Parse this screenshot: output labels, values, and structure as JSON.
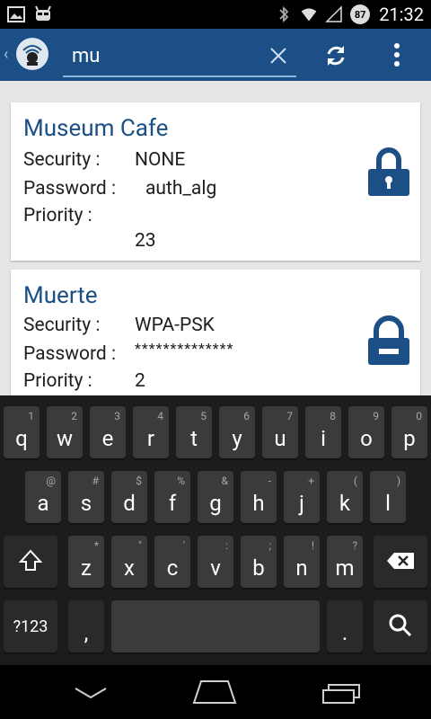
{
  "status": {
    "time": "21:32",
    "battery": "87"
  },
  "search": {
    "value": "mu"
  },
  "networks": [
    {
      "name": "Museum Cafe",
      "security_label": "Security :",
      "security": "NONE",
      "password_label": "Password :",
      "password": "auth_alg",
      "priority_label": "Priority :",
      "priority": "23"
    },
    {
      "name": "Muerte",
      "security_label": "Security :",
      "security": "WPA-PSK",
      "password_label": "Password :",
      "password": "**************",
      "priority_label": "Priority :",
      "priority": "2"
    }
  ],
  "keyboard": {
    "row1": [
      {
        "k": "q",
        "h": "1"
      },
      {
        "k": "w",
        "h": "2"
      },
      {
        "k": "e",
        "h": "3"
      },
      {
        "k": "r",
        "h": "4"
      },
      {
        "k": "t",
        "h": "5"
      },
      {
        "k": "y",
        "h": "6"
      },
      {
        "k": "u",
        "h": "7"
      },
      {
        "k": "i",
        "h": "8"
      },
      {
        "k": "o",
        "h": "9"
      },
      {
        "k": "p",
        "h": "0"
      }
    ],
    "row2": [
      {
        "k": "a",
        "h": "@"
      },
      {
        "k": "s",
        "h": "#"
      },
      {
        "k": "d",
        "h": "$"
      },
      {
        "k": "f",
        "h": "%"
      },
      {
        "k": "g",
        "h": "&"
      },
      {
        "k": "h",
        "h": "-"
      },
      {
        "k": "j",
        "h": "+"
      },
      {
        "k": "k",
        "h": "("
      },
      {
        "k": "l",
        "h": ")"
      }
    ],
    "row3": [
      {
        "k": "z",
        "h": "*"
      },
      {
        "k": "x",
        "h": "\""
      },
      {
        "k": "c",
        "h": "'"
      },
      {
        "k": "v",
        "h": ":"
      },
      {
        "k": "b",
        "h": ";"
      },
      {
        "k": "n",
        "h": "!"
      },
      {
        "k": "m",
        "h": "?"
      }
    ],
    "symbols_label": "?123",
    "comma": ",",
    "period": "."
  }
}
